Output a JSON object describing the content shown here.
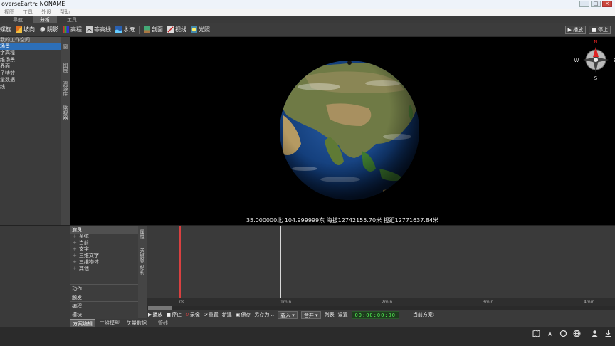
{
  "window": {
    "title": "overseEarth: NONAME"
  },
  "menu": [
    "视图",
    "工具",
    "外设",
    "帮助"
  ],
  "ribbon_tabs": [
    {
      "label": "导航",
      "active": false
    },
    {
      "label": "分析",
      "active": true
    },
    {
      "label": "工具",
      "active": false
    }
  ],
  "toolbar": {
    "items": [
      "螺旋",
      "坡向",
      "阴影",
      "高程",
      "等高线",
      "水淹",
      "剖面",
      "视线",
      "光照"
    ],
    "right": [
      "播放",
      "停止"
    ]
  },
  "left_panel": {
    "header": "我的工作空间",
    "selected": "场景",
    "items": [
      "字高程",
      "维场景",
      "界面",
      "子特效",
      "量数据",
      "线"
    ]
  },
  "vtabs_top": [
    "窗",
    "图层",
    "资源库",
    "监视器"
  ],
  "viewport": {
    "status": "35.000000北 104.999999东 海拔12742155.70米 视距12771637.84米"
  },
  "compass": {
    "n": "N",
    "s": "S",
    "w": "W",
    "e": "E"
  },
  "effects_panel": {
    "header": "演员",
    "tree": [
      "系统",
      "当前",
      "文字",
      "三维文字",
      "三维物体",
      "其他"
    ],
    "sections": [
      "动作",
      "触发",
      "编程",
      "模块"
    ]
  },
  "vtabs_bottom": [
    "属性",
    "关键帧",
    "结构"
  ],
  "timeline": {
    "ticks": [
      "0s",
      "1min",
      "2min",
      "3min",
      "4min"
    ]
  },
  "playbar": {
    "play": "播放",
    "stop": "停止",
    "record": "录像",
    "reset": "重置",
    "new": "新建",
    "save": "保存",
    "save_as": "另存为...",
    "load": "载入",
    "merge": "合并",
    "list": "列表",
    "settings": "设置",
    "timecode": "00:00:00:00",
    "current_scheme_label": "当前方案:"
  },
  "bottom_tabs": [
    {
      "label": "方案编辑",
      "active": true
    },
    {
      "label": "三维模型",
      "active": false
    },
    {
      "label": "矢量数据",
      "active": false
    },
    {
      "label": "管线",
      "active": false
    }
  ]
}
